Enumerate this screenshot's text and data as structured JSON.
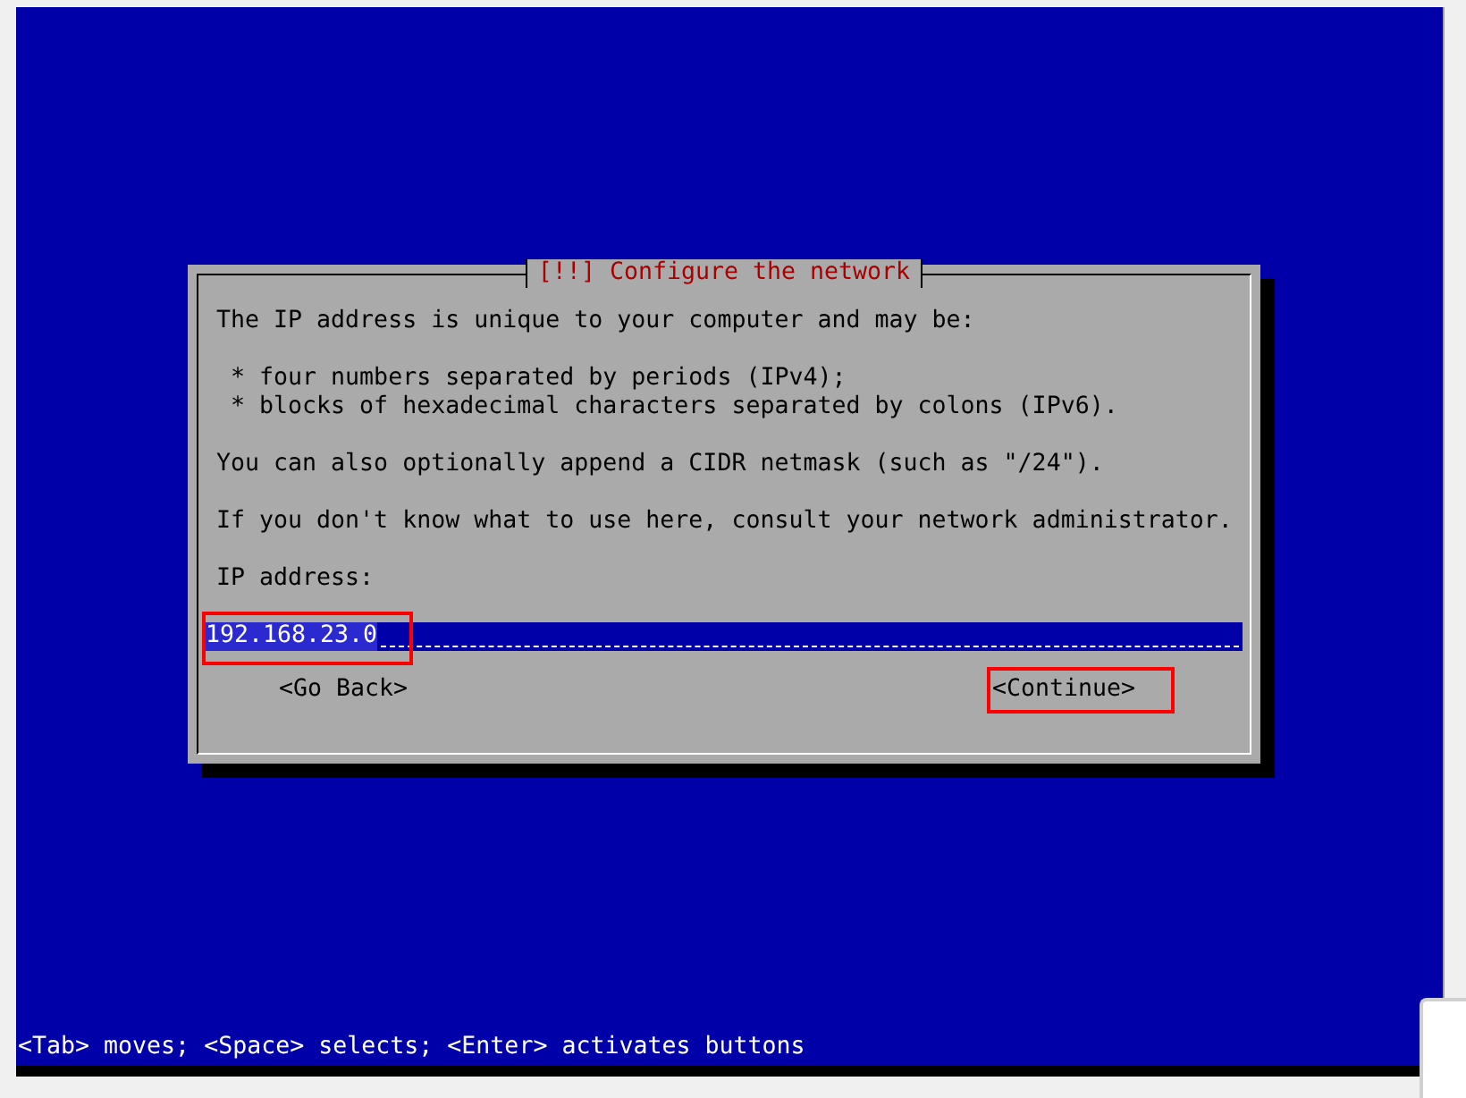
{
  "dialog": {
    "title": "[!!] Configure the network",
    "paragraphs": [
      [
        "The IP address is unique to your computer and may be:"
      ],
      [
        " * four numbers separated by periods (IPv4);",
        " * blocks of hexadecimal characters separated by colons (IPv6)."
      ],
      [
        "You can also optionally append a CIDR netmask (such as \"/24\")."
      ],
      [
        "If you don't know what to use here, consult your network administrator."
      ]
    ],
    "field": {
      "label": "IP address:",
      "value": "192.168.23.0",
      "annotated": true
    },
    "buttons": [
      {
        "label": "<Go Back>",
        "annotated": false
      },
      {
        "label": "<Continue>",
        "annotated": true
      }
    ]
  },
  "status_bar": "<Tab> moves; <Space> selects; <Enter> activates buttons"
}
